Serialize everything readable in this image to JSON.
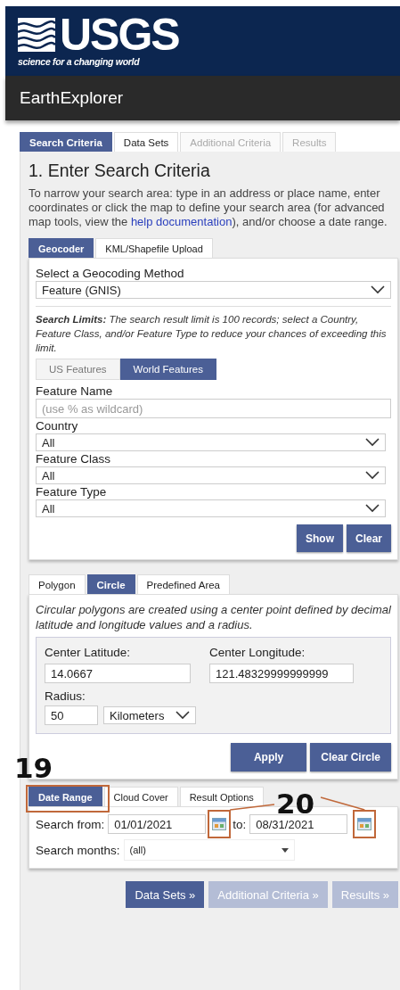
{
  "logo": {
    "wordmark": "USGS",
    "tagline": "science for a changing world"
  },
  "app_title": "EarthExplorer",
  "tabs": [
    {
      "label": "Search Criteria",
      "selected": true,
      "disabled": false
    },
    {
      "label": "Data Sets",
      "selected": false,
      "disabled": false
    },
    {
      "label": "Additional Criteria",
      "selected": false,
      "disabled": true
    },
    {
      "label": "Results",
      "selected": false,
      "disabled": true
    }
  ],
  "heading": "1. Enter Search Criteria",
  "intro": {
    "before": "To narrow your search area: type in an address or place name, enter coordinates or click the map to define your search area (for advanced map tools, view the ",
    "link": "help documentation",
    "after": "), and/or choose a date range."
  },
  "geocoder": {
    "tabs": [
      {
        "label": "Geocoder",
        "selected": true
      },
      {
        "label": "KML/Shapefile Upload",
        "selected": false
      }
    ],
    "method_label": "Select a Geocoding Method",
    "method_value": "Feature (GNIS)",
    "limits": "**Search Limits:** The search result limit is 100 records; select a Country, Feature Class, and/or Feature Type to reduce your chances of exceeding this limit.",
    "feature_tabs": [
      {
        "label": "US Features",
        "selected": false
      },
      {
        "label": "World Features",
        "selected": true
      }
    ],
    "feature_name": {
      "label": "Feature Name",
      "placeholder": "(use % as wildcard)"
    },
    "selects": [
      {
        "label": "Country",
        "value": "All"
      },
      {
        "label": "Feature Class",
        "value": "All"
      },
      {
        "label": "Feature Type",
        "value": "All"
      }
    ],
    "buttons": [
      "Show",
      "Clear"
    ]
  },
  "area": {
    "tabs": [
      {
        "label": "Polygon",
        "selected": false
      },
      {
        "label": "Circle",
        "selected": true
      },
      {
        "label": "Predefined Area",
        "selected": false
      }
    ],
    "description": "Circular polygons are created using a center point defined by decimal latitude and longitude values and a radius.",
    "latitude": {
      "label": "Center Latitude:",
      "value": "14.0667"
    },
    "longitude": {
      "label": "Center Longitude:",
      "value": "121.48329999999999"
    },
    "radius": {
      "label": "Radius:",
      "value": "50",
      "unit": "Kilometers"
    },
    "buttons": [
      "Apply",
      "Clear Circle"
    ]
  },
  "date": {
    "tabs": [
      {
        "label": "Date Range",
        "selected": true
      },
      {
        "label": "Cloud Cover",
        "selected": false
      },
      {
        "label": "Result Options",
        "selected": false
      }
    ],
    "from": {
      "label": "Search from:",
      "value": "01/01/2021"
    },
    "to": {
      "label": "to:",
      "value": "08/31/2021"
    },
    "months": {
      "label": "Search months:",
      "value": "(all)"
    }
  },
  "nav_buttons": [
    {
      "label": "Data Sets »",
      "disabled": false
    },
    {
      "label": "Additional Criteria »",
      "disabled": true
    },
    {
      "label": "Results »",
      "disabled": true
    }
  ],
  "annotations": [
    {
      "label": "19"
    },
    {
      "label": "20"
    }
  ]
}
